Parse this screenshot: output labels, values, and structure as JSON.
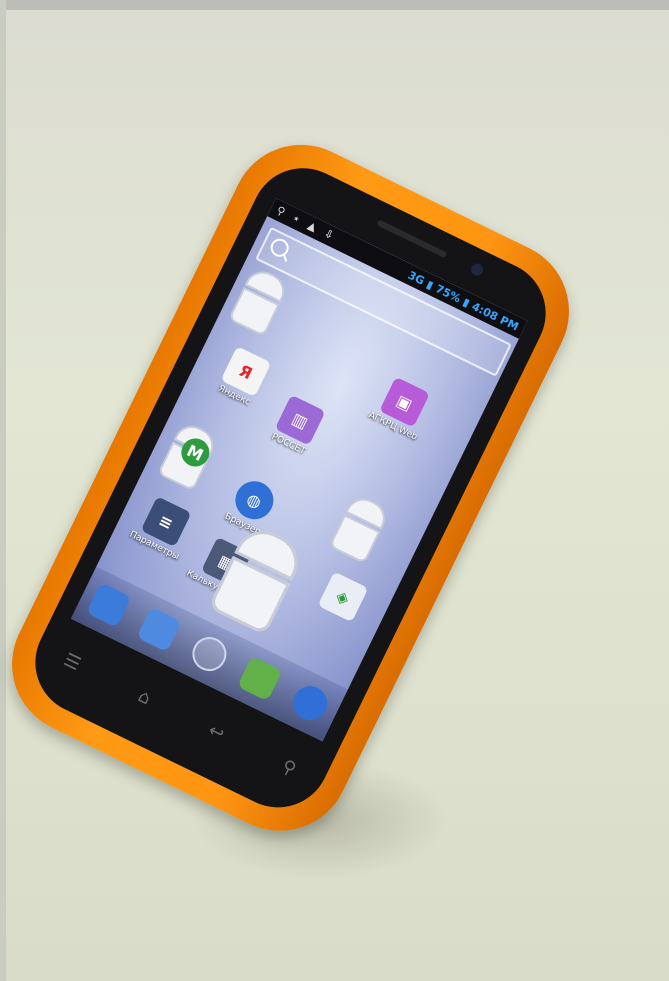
{
  "status_bar": {
    "network": "3G",
    "battery": "75%",
    "time": "4:08 PM"
  },
  "apps": [
    {
      "label": "Яндекс",
      "glyph": "Я"
    },
    {
      "label": "РОССЕТ",
      "glyph": ""
    },
    {
      "label": "АГКРЦ Web",
      "glyph": ""
    },
    {
      "label": "Браузер",
      "glyph": ""
    },
    {
      "label": "Параметры",
      "glyph": ""
    },
    {
      "label": "Калькулятор",
      "glyph": ""
    }
  ],
  "icons": {
    "search": "search-icon",
    "nav": [
      "menu-icon",
      "home-icon",
      "back-icon",
      "search-key-icon"
    ]
  },
  "colors": {
    "bumper": "#ff9512",
    "screen": "#b7c0e4",
    "accent_status": "#35a7ff"
  }
}
